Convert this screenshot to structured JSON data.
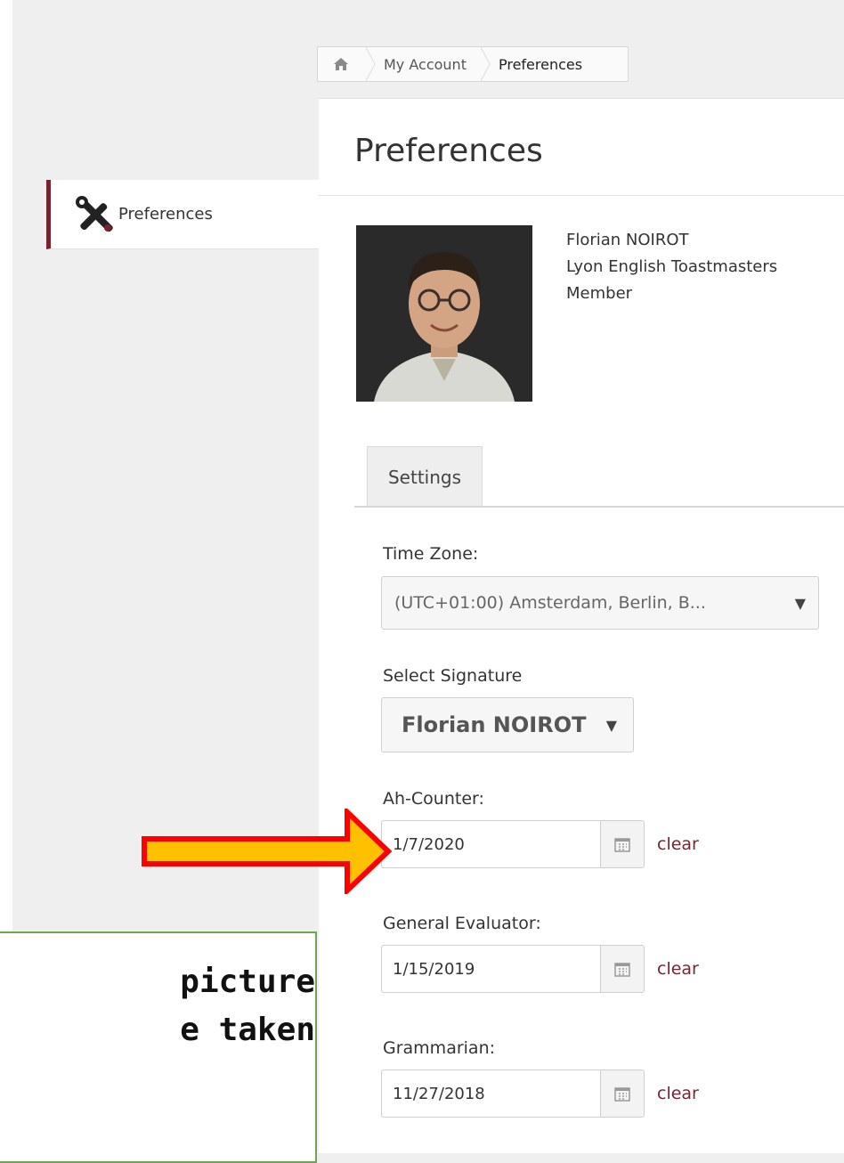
{
  "breadcrumb": {
    "home_icon": "home-icon",
    "items": [
      "My Account",
      "Preferences"
    ]
  },
  "sidebar": {
    "item": {
      "label": "Preferences",
      "icon": "tools-icon"
    },
    "accent": "#772432"
  },
  "page": {
    "title": "Preferences"
  },
  "profile": {
    "name": "Florian NOIROT",
    "club": "Lyon English Toastmasters",
    "role": "Member"
  },
  "tabs": [
    {
      "label": "Settings"
    }
  ],
  "settings": {
    "time_zone": {
      "label": "Time Zone:",
      "value": "(UTC+01:00) Amsterdam, Berlin, B..."
    },
    "signature": {
      "label": "Select Signature",
      "value": "Florian NOIROT"
    },
    "dates": [
      {
        "label": "Ah-Counter:",
        "value": "1/7/2020",
        "action": "clear"
      },
      {
        "label": "General Evaluator:",
        "value": "1/15/2019",
        "action": "clear"
      },
      {
        "label": "Grammarian:",
        "value": "11/27/2018",
        "action": "clear"
      }
    ]
  },
  "annotation": {
    "text_line1": "picture",
    "text_line2": "e taken",
    "arrow_fill": "#ffc000",
    "arrow_stroke": "#ff0000",
    "box_border": "#6aa84f"
  }
}
